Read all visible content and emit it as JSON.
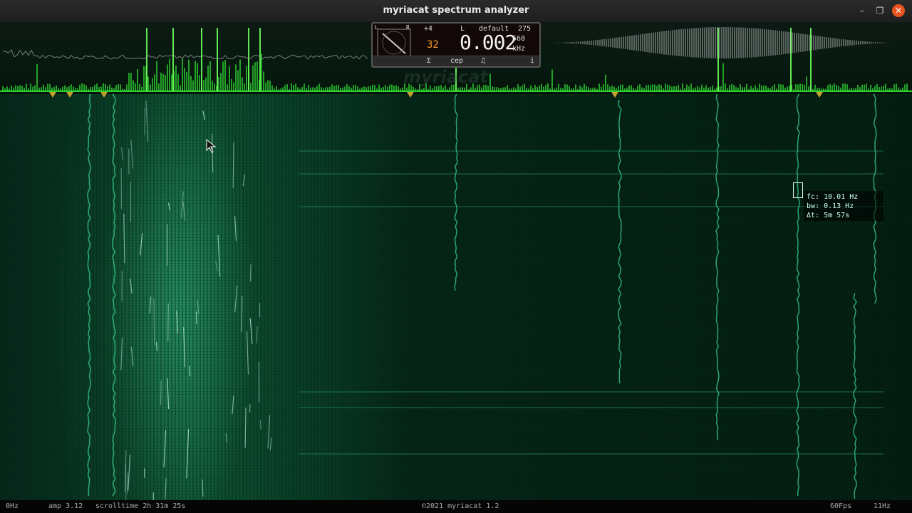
{
  "window": {
    "title": "myriacat spectrum analyzer",
    "buttons": {
      "minimize": "–",
      "maximize": "❐",
      "close": "✕"
    }
  },
  "panel": {
    "offset": "+4",
    "channel": "L",
    "preset": "default",
    "preset_num": "275",
    "gain": "32",
    "frequency": "0.002",
    "bins": "568",
    "unit": "kHz",
    "dial_labels": {
      "left": "L",
      "right": "R"
    },
    "buttons": {
      "sum": "Σ",
      "cep": "cep",
      "note": "♫",
      "info": "i"
    }
  },
  "watermark": "myriacat",
  "readout": {
    "fc": "fc: 10.01 Hz",
    "bw": "bw: 0.13 Hz",
    "dt": "Δt: 5m 57s"
  },
  "status": {
    "min_freq": "0Hz",
    "amp": "amp 3.12",
    "scrolltime": "scrolltime 2h 31m 25s",
    "copyright": "©2021 myriacat 1.2",
    "fps": "60Fps",
    "max_freq": "11Hz"
  },
  "colors": {
    "spectrum": "#39ff3a",
    "waterfall": "#0a3a26",
    "marker": "#c8a030",
    "close_button": "#e95420"
  }
}
